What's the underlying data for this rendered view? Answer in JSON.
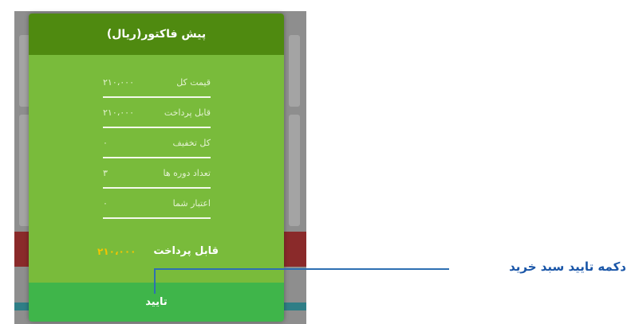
{
  "dialog": {
    "title": "پیش فاکتور(ریال)",
    "rows": [
      {
        "label": "قیمت کل",
        "value": "۲۱۰،۰۰۰"
      },
      {
        "label": "قابل پرداخت",
        "value": "۲۱۰،۰۰۰"
      },
      {
        "label": "کل تخفیف",
        "value": "۰"
      },
      {
        "label": "تعداد دوره ها",
        "value": "۳"
      },
      {
        "label": "اعتبار شما",
        "value": "۰"
      }
    ],
    "total": {
      "label": "قابل پرداخت",
      "value": "۲۱۰،۰۰۰"
    },
    "confirm_label": "تایید"
  },
  "annotation": {
    "text": "دکمه تایید سبد خرید"
  },
  "colors": {
    "header": "#4f8a10",
    "body": "#79bb3b",
    "confirm": "#3fb54a",
    "total_value": "#f6c500",
    "annotation": "#1a56a8"
  }
}
